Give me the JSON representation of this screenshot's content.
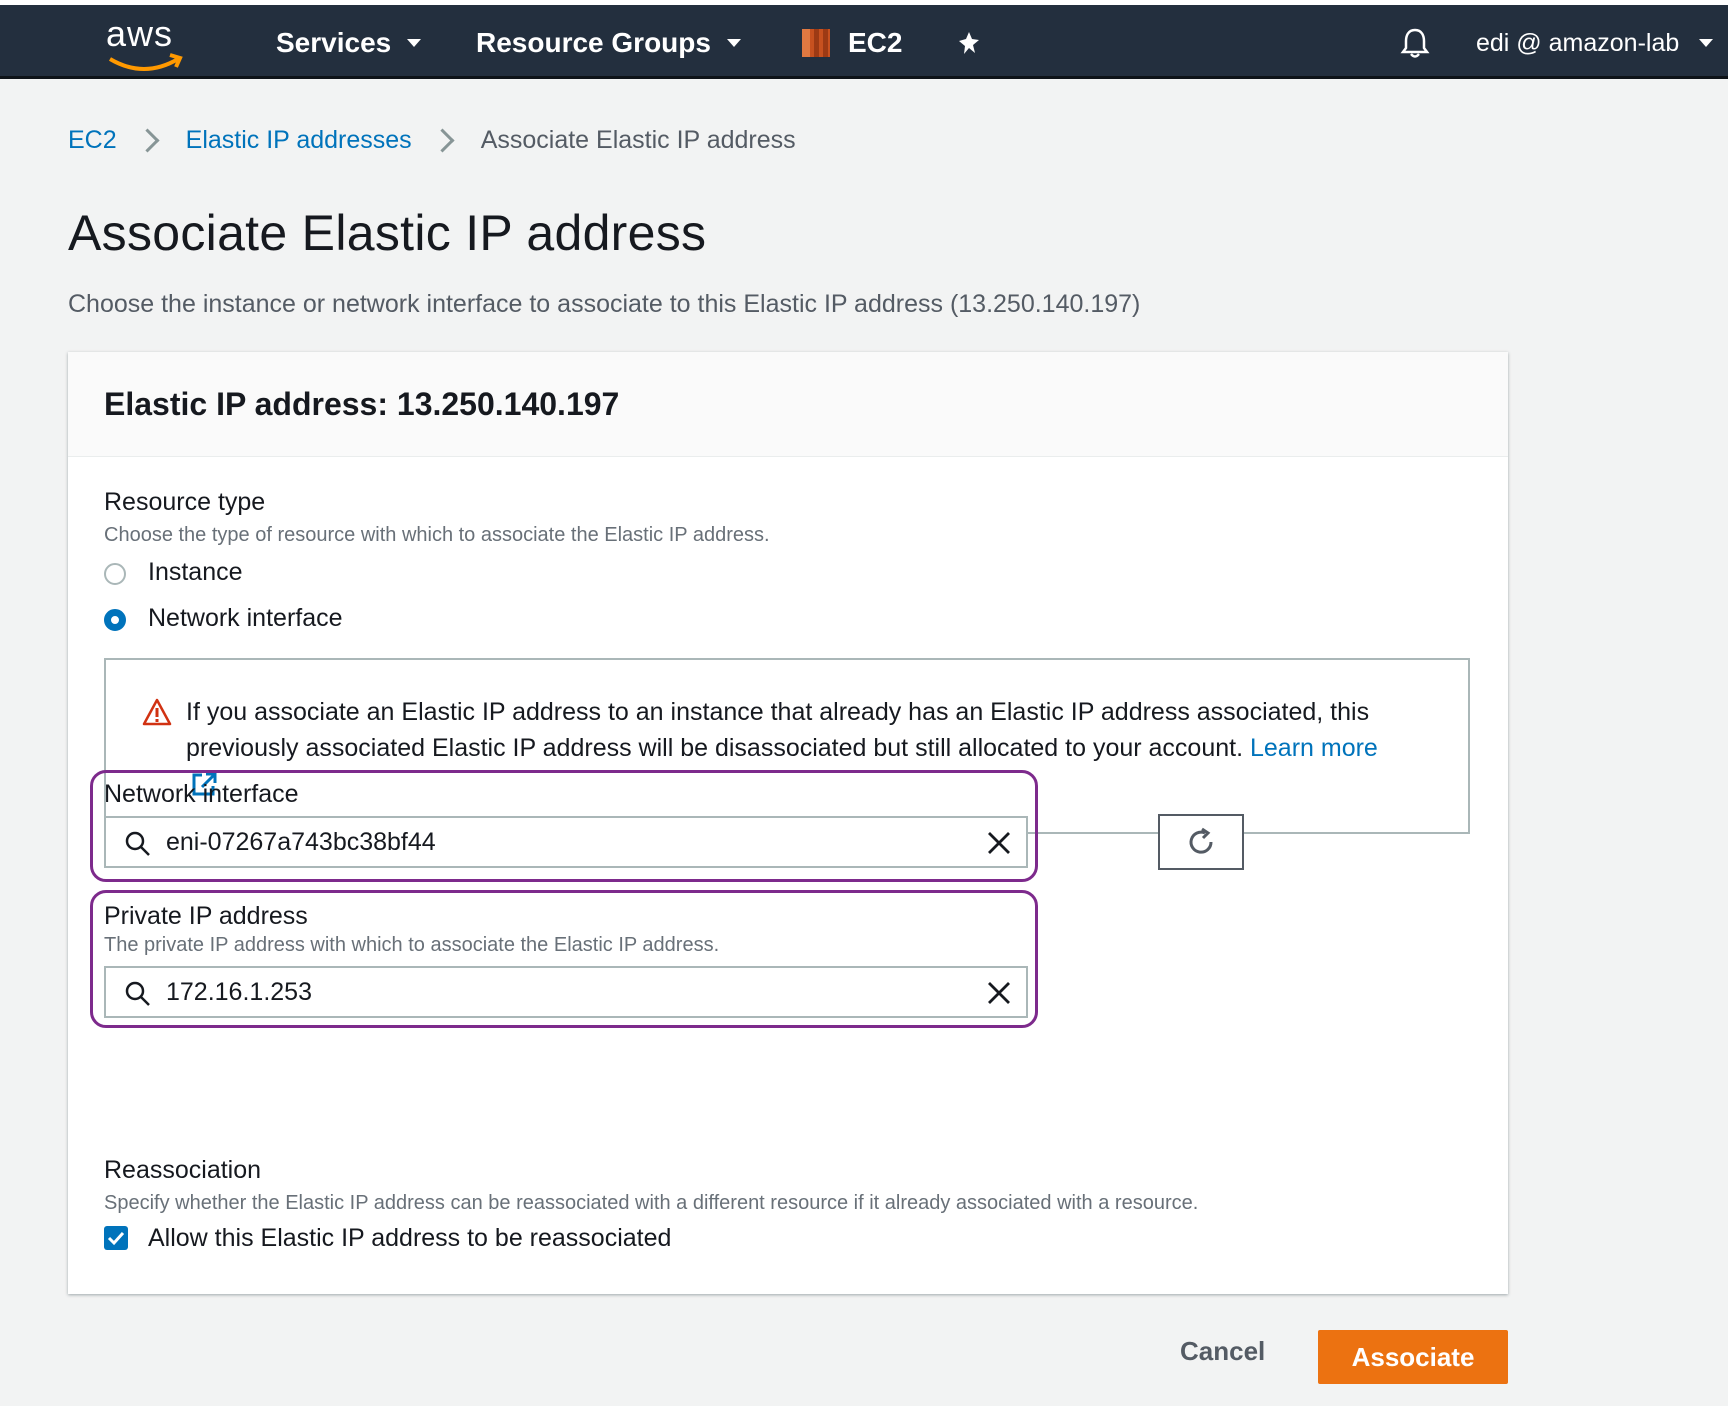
{
  "topbar": {
    "logo": "aws",
    "services": "Services",
    "resource_groups": "Resource Groups",
    "service_name": "EC2",
    "user": "edi @ amazon-lab"
  },
  "breadcrumb": {
    "items": [
      "EC2",
      "Elastic IP addresses",
      "Associate Elastic IP address"
    ]
  },
  "page": {
    "title": "Associate Elastic IP address",
    "description": "Choose the instance or network interface to associate to this Elastic IP address (13.250.140.197)"
  },
  "panel": {
    "header": "Elastic IP address: 13.250.140.197",
    "resource_type": {
      "label": "Resource type",
      "hint": "Choose the type of resource with which to associate the Elastic IP address.",
      "options": [
        "Instance",
        "Network interface"
      ],
      "selected": "Network interface"
    },
    "alert": {
      "text": "If you associate an Elastic IP address to an instance that already has an Elastic IP address associated, this previously associated Elastic IP address will be disassociated but still allocated to your account.",
      "link": "Learn more"
    },
    "network_interface": {
      "label": "Network interface",
      "value": "eni-07267a743bc38bf44"
    },
    "private_ip": {
      "label": "Private IP address",
      "hint": "The private IP address with which to associate the Elastic IP address.",
      "value": "172.16.1.253"
    },
    "reassociation": {
      "label": "Reassociation",
      "hint": "Specify whether the Elastic IP address can be reassociated with a different resource if it already associated with a resource.",
      "checkbox_label": "Allow this Elastic IP address to be reassociated",
      "checked": true
    }
  },
  "actions": {
    "cancel": "Cancel",
    "associate": "Associate"
  },
  "colors": {
    "topbar": "#232f3e",
    "link": "#0073bb",
    "primary": "#ec7211",
    "highlight": "#7d2a8c",
    "warning": "#d13212"
  }
}
